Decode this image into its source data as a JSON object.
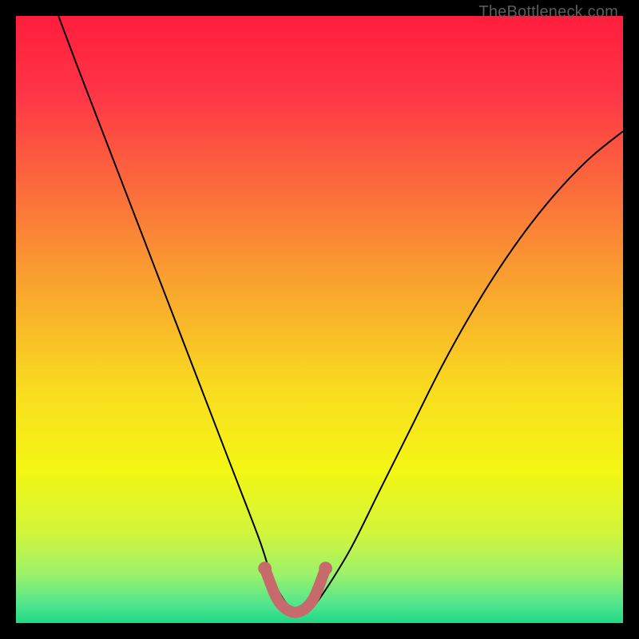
{
  "watermark": "TheBottleneck.com",
  "chart_data": {
    "type": "line",
    "title": "",
    "xlabel": "",
    "ylabel": "",
    "xlim": [
      0,
      100
    ],
    "ylim": [
      0,
      100
    ],
    "grid": false,
    "legend": false,
    "annotations": [],
    "series": [
      {
        "name": "bottleneck-curve",
        "x": [
          7,
          10,
          15,
          20,
          25,
          30,
          35,
          40,
          42,
          44,
          46,
          48,
          50,
          55,
          60,
          65,
          70,
          75,
          80,
          85,
          90,
          95,
          100
        ],
        "y": [
          100,
          92,
          79,
          66,
          53,
          40,
          27,
          14,
          8,
          4,
          2,
          2,
          4,
          12,
          22,
          32,
          42,
          51,
          59,
          66,
          72,
          77,
          81
        ],
        "color": "#000000"
      },
      {
        "name": "highlight-bottom",
        "x": [
          41,
          43,
          45,
          47,
          49,
          51
        ],
        "y": [
          9,
          4,
          2,
          2,
          4,
          9
        ],
        "color": "#C66A6B"
      }
    ],
    "background_gradient_stops": [
      {
        "offset": 0.0,
        "color": "#FF1E3C"
      },
      {
        "offset": 0.12,
        "color": "#FF3347"
      },
      {
        "offset": 0.28,
        "color": "#FB6A3C"
      },
      {
        "offset": 0.45,
        "color": "#F9A62E"
      },
      {
        "offset": 0.62,
        "color": "#F9DD1F"
      },
      {
        "offset": 0.75,
        "color": "#F3F714"
      },
      {
        "offset": 0.85,
        "color": "#D3F53A"
      },
      {
        "offset": 0.92,
        "color": "#9CF26B"
      },
      {
        "offset": 0.97,
        "color": "#4FE58E"
      },
      {
        "offset": 1.0,
        "color": "#1FD885"
      }
    ]
  }
}
